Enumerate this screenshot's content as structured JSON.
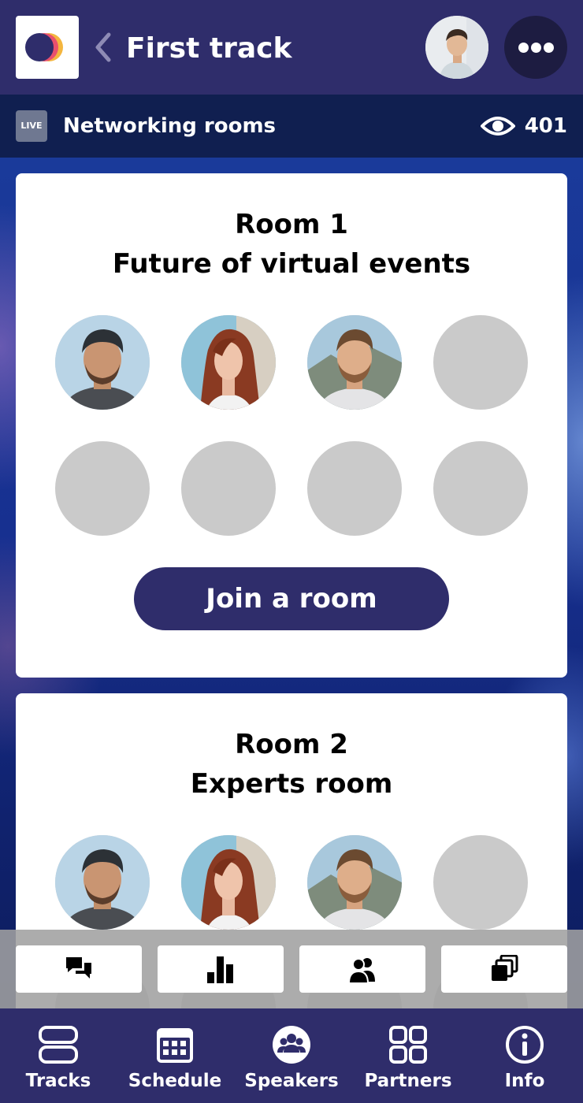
{
  "header": {
    "title": "First track",
    "back_icon": "chevron-left-icon",
    "more_icon": "more-dots-icon"
  },
  "live_bar": {
    "badge": "LIVE",
    "title": "Networking rooms",
    "viewer_count": "401",
    "viewer_icon": "eye-icon"
  },
  "rooms": [
    {
      "name": "Room 1",
      "topic": "Future of virtual events",
      "join_label": "Join a room",
      "seats": [
        "man-beanie",
        "woman-redhead",
        "man-beard",
        "empty",
        "empty",
        "empty",
        "empty",
        "empty"
      ]
    },
    {
      "name": "Room 2",
      "topic": "Experts room",
      "seats": [
        "man-beanie",
        "woman-redhead",
        "man-beard",
        "empty"
      ]
    }
  ],
  "toolbar": [
    "chat-icon",
    "poll-chart-icon",
    "attendees-icon",
    "slides-icon"
  ],
  "bottom_nav": [
    {
      "label": "Tracks",
      "icon": "tracks-icon"
    },
    {
      "label": "Schedule",
      "icon": "calendar-icon"
    },
    {
      "label": "Speakers",
      "icon": "speakers-icon"
    },
    {
      "label": "Partners",
      "icon": "partners-grid-icon"
    },
    {
      "label": "Info",
      "icon": "info-icon"
    }
  ],
  "colors": {
    "brand": "#2f2d6b",
    "live_bar": "#101f50",
    "seat_empty": "#cacaca"
  }
}
